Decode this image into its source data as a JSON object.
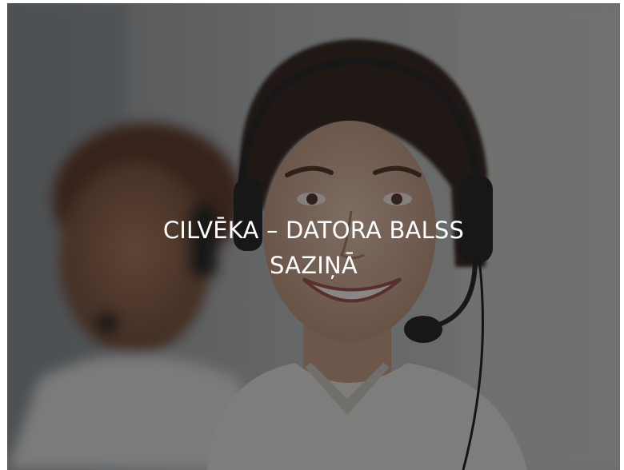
{
  "slide": {
    "title_line1": "CILVĒKA – DATORA BALSS",
    "title_line2": "SAZIŅĀ"
  },
  "colors": {
    "overlay": "#141414",
    "title_text": "#ffffff"
  },
  "background_photo": {
    "subject": "smiling call-center agent wearing a headset with boom microphone, colleague with headset blurred in background"
  }
}
